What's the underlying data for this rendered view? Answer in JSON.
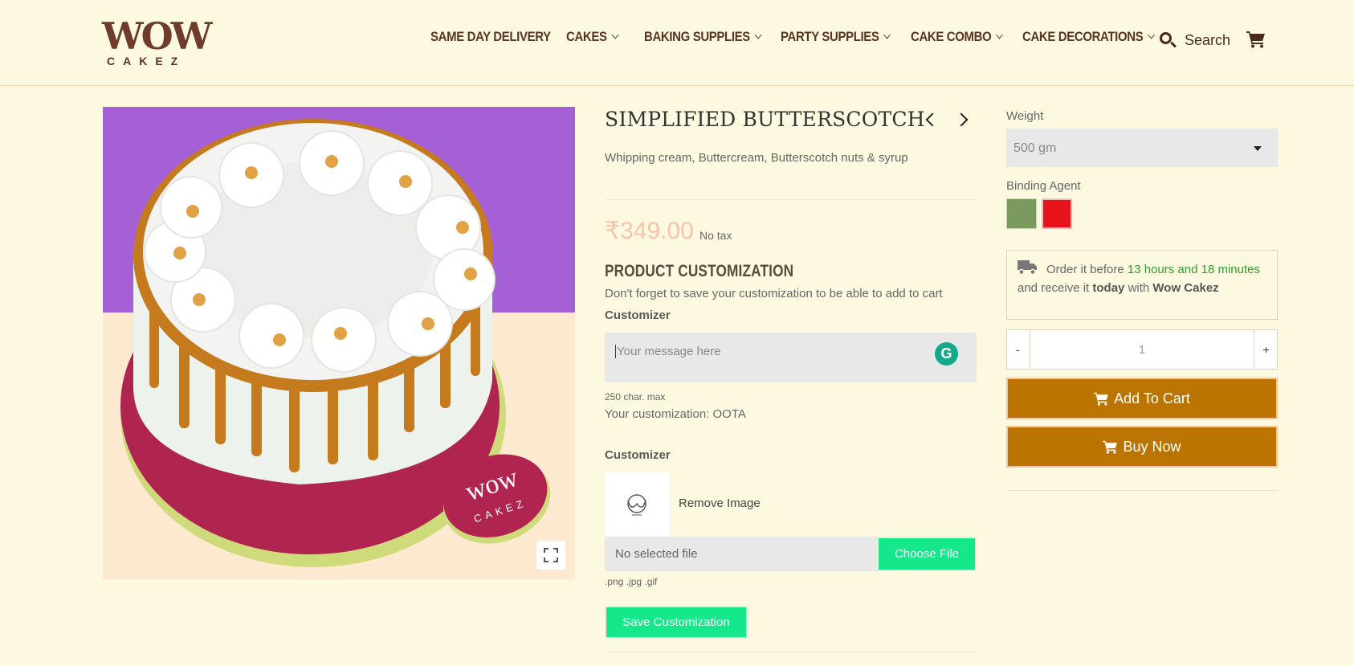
{
  "header": {
    "logo_top": "WOW",
    "logo_bottom": "CAKEZ",
    "nav": [
      {
        "label": "SAME DAY DELIVERY",
        "has_dropdown": false
      },
      {
        "label": "CAKES",
        "has_dropdown": true
      },
      {
        "label": "BAKING SUPPLIES",
        "has_dropdown": true
      },
      {
        "label": "PARTY SUPPLIES",
        "has_dropdown": true
      },
      {
        "label": "CAKE COMBO",
        "has_dropdown": true
      },
      {
        "label": "CAKE DECORATIONS",
        "has_dropdown": true
      }
    ],
    "search_label": "Search",
    "search_icon": "search-icon",
    "cart_icon": "cart-icon"
  },
  "product": {
    "title": "SIMPLIFIED BUTTERSCOTCH",
    "description": "Whipping cream, Buttercream, Butterscotch nuts & syrup",
    "price": "₹349.00",
    "tax_note": "No tax",
    "image_badge_text": "CAKEZ"
  },
  "customization": {
    "heading": "PRODUCT CUSTOMIZATION",
    "hint": "Don't forget to save your customization to be able to add to cart",
    "text_customizer_label": "Customizer",
    "message_placeholder": "Your message here",
    "char_limit": "250 char. max",
    "current_value": "Your customization: OOTA",
    "image_customizer_label": "Customizer",
    "remove_image": "Remove Image",
    "file_status": "No selected file",
    "choose_file": "Choose File",
    "file_types": ".png .jpg .gif",
    "save_button": "Save Customization"
  },
  "options": {
    "weight_label": "Weight",
    "weight_value": "500 gm",
    "binding_label": "Binding Agent",
    "swatches": [
      {
        "name": "green",
        "color": "#7b9a5e"
      },
      {
        "name": "red",
        "color": "#e8121b"
      }
    ]
  },
  "delivery": {
    "prefix": "Order it before ",
    "countdown": "13 hours and 18 minutes",
    "line2_pre": "and receive it ",
    "today": "today",
    "line2_mid": " with ",
    "store": "Wow Cakez"
  },
  "purchase": {
    "qty_minus": "-",
    "qty_value": "1",
    "qty_plus": "+",
    "add_to_cart": "Add To Cart",
    "buy_now": "Buy Now"
  },
  "colors": {
    "background": "#fcf9e0",
    "brand_brown": "#5a3422",
    "cta": "#bb7400",
    "accent_green": "#15e88a",
    "price_pink": "#f7c3ab"
  }
}
